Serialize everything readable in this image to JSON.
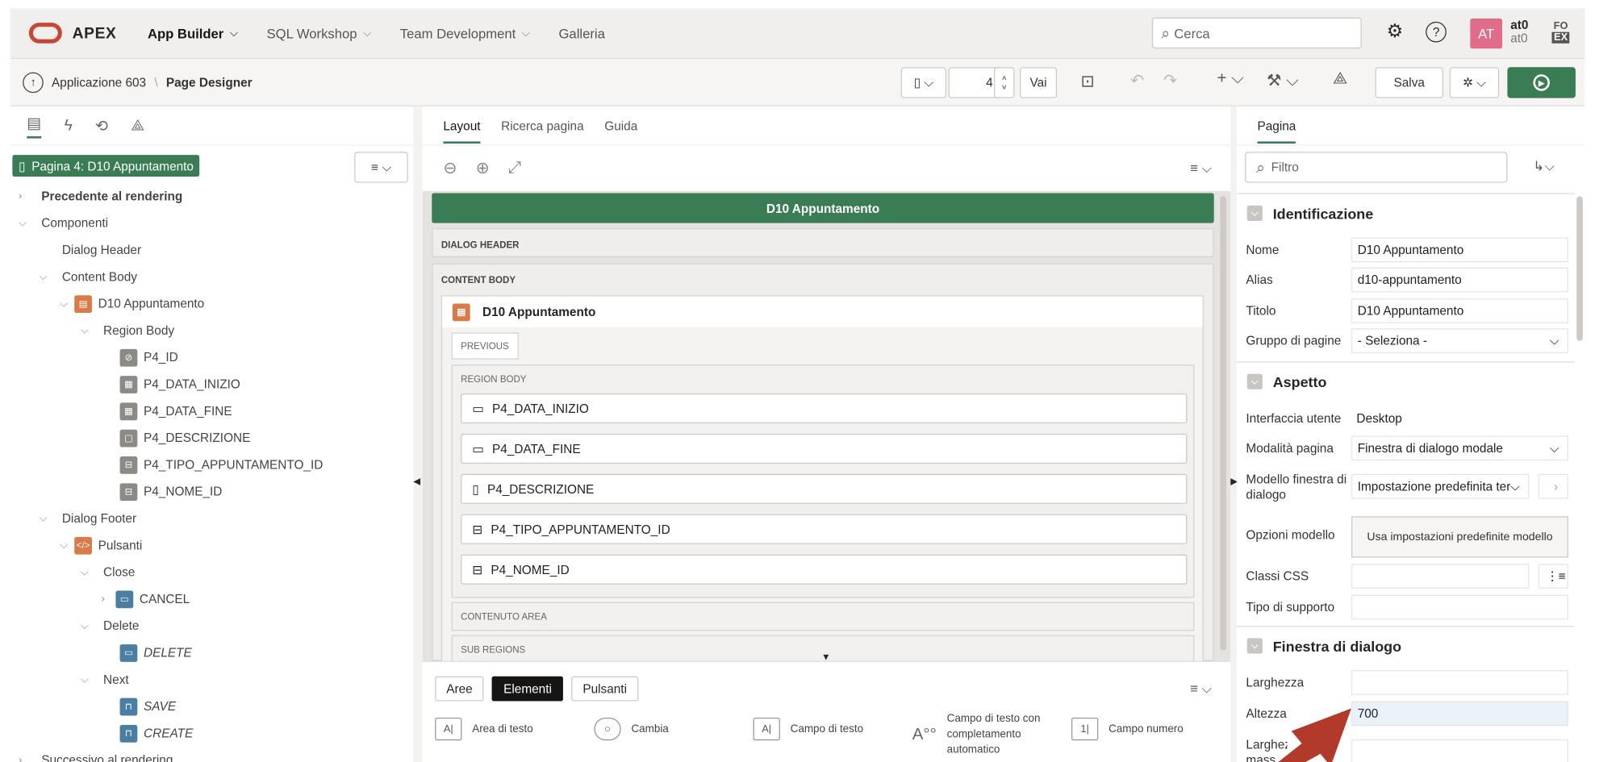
{
  "header": {
    "brand": "APEX",
    "nav": [
      {
        "label": "App Builder",
        "active": true,
        "has_menu": true
      },
      {
        "label": "SQL Workshop",
        "active": false,
        "has_menu": true
      },
      {
        "label": "Team Development",
        "active": false,
        "has_menu": true
      },
      {
        "label": "Galleria",
        "active": false,
        "has_menu": false
      }
    ],
    "search_placeholder": "Cerca",
    "avatar_initials": "AT",
    "user_name": "at0",
    "user_workspace": "at0",
    "badge_top": "FO",
    "badge_bottom": "EX"
  },
  "toolbar": {
    "breadcrumb_app": "Applicazione 603",
    "breadcrumb_page": "Page Designer",
    "page_number": "4",
    "go_label": "Vai",
    "save_label": "Salva"
  },
  "left_panel": {
    "page_button": "Pagina 4: D10 Appuntamento",
    "tree": [
      {
        "label": "Precedente al rendering",
        "bold": true
      },
      {
        "label": "Componenti"
      },
      {
        "label": "Dialog Header"
      },
      {
        "label": "Content Body"
      },
      {
        "label": "D10 Appuntamento"
      },
      {
        "label": "Region Body"
      },
      {
        "label": "P4_ID"
      },
      {
        "label": "P4_DATA_INIZIO"
      },
      {
        "label": "P4_DATA_FINE"
      },
      {
        "label": "P4_DESCRIZIONE"
      },
      {
        "label": "P4_TIPO_APPUNTAMENTO_ID"
      },
      {
        "label": "P4_NOME_ID"
      },
      {
        "label": "Dialog Footer"
      },
      {
        "label": "Pulsanti"
      },
      {
        "label": "Close"
      },
      {
        "label": "CANCEL"
      },
      {
        "label": "Delete"
      },
      {
        "label": "DELETE"
      },
      {
        "label": "Next"
      },
      {
        "label": "SAVE"
      },
      {
        "label": "CREATE"
      },
      {
        "label": "Successivo al rendering"
      }
    ]
  },
  "center_panel": {
    "tabs": [
      "Layout",
      "Ricerca pagina",
      "Guida"
    ],
    "dialog_title": "D10 Appuntamento",
    "dialog_header": "DIALOG HEADER",
    "content_body": "CONTENT BODY",
    "region_title": "D10 Appuntamento",
    "previous_chip": "PREVIOUS",
    "region_body": "REGION BODY",
    "items": [
      "P4_DATA_INIZIO",
      "P4_DATA_FINE",
      "P4_DESCRIZIONE",
      "P4_TIPO_APPUNTAMENTO_ID",
      "P4_NOME_ID"
    ],
    "contenuto_area": "CONTENUTO AREA",
    "sub_regions": "SUB REGIONS",
    "gallery_tabs": [
      "Aree",
      "Elementi",
      "Pulsanti"
    ],
    "gallery_items": [
      {
        "icon": "A|",
        "label": "Area di testo"
      },
      {
        "icon": "○",
        "label": "Cambia"
      },
      {
        "icon": "A|",
        "label": "Campo di testo"
      },
      {
        "icon": "A°°",
        "label": "Campo di testo con completamento automatico"
      },
      {
        "icon": "1|",
        "label": "Campo numero"
      }
    ]
  },
  "right_panel": {
    "tab": "Pagina",
    "filter_placeholder": "Filtro",
    "sections": {
      "identificazione": "Identificazione",
      "aspetto": "Aspetto",
      "finestra": "Finestra di dialogo"
    },
    "props": {
      "nome_label": "Nome",
      "nome_value": "D10 Appuntamento",
      "alias_label": "Alias",
      "alias_value": "d10-appuntamento",
      "titolo_label": "Titolo",
      "titolo_value": "D10 Appuntamento",
      "gruppo_label": "Gruppo di pagine",
      "gruppo_value": "- Seleziona -",
      "ui_label": "Interfaccia utente",
      "ui_value": "Desktop",
      "modalita_label": "Modalità pagina",
      "modalita_value": "Finestra di dialogo modale",
      "modello_label": "Modello finestra di dialogo",
      "modello_value": "Impostazione predefinita ter",
      "opzioni_label": "Opzioni modello",
      "opzioni_button": "Usa impostazioni predefinite modello",
      "css_label": "Classi CSS",
      "css_value": "",
      "supporto_label": "Tipo di supporto",
      "supporto_value": "",
      "larghezza_label": "Larghezza",
      "larghezza_value": "",
      "altezza_label": "Altezza",
      "altezza_value": "700",
      "largmax_label": "Larghezza mass"
    }
  },
  "colors": {
    "accent": "#3a7d55",
    "oracle_red": "#c74634",
    "avatar": "#e06c8a",
    "arrow": "#b23a2a"
  }
}
